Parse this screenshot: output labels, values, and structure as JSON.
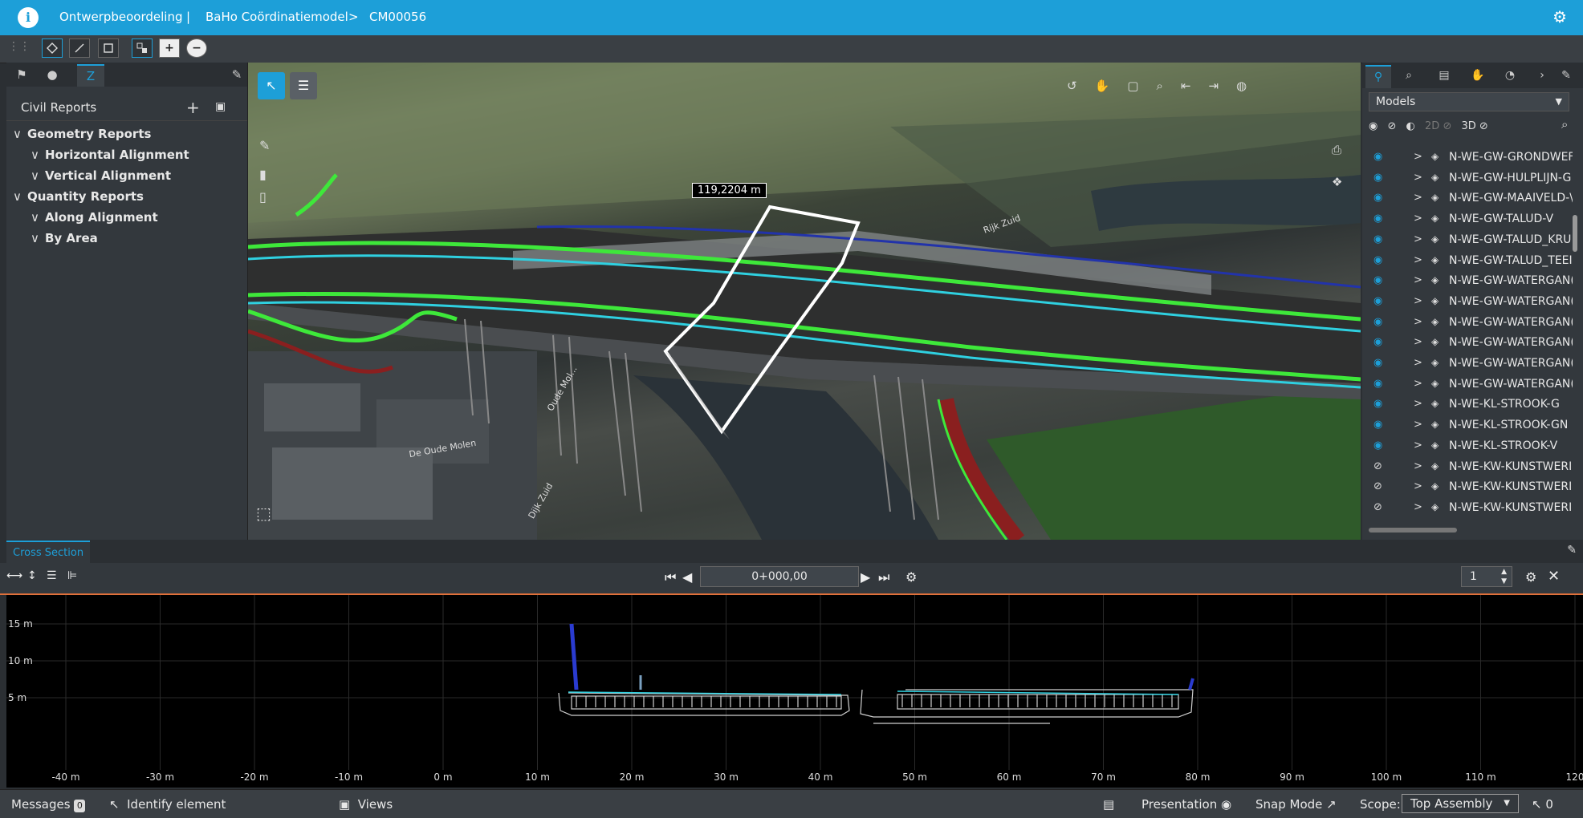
{
  "header": {
    "logo_glyph": "i",
    "project": "Ontwerpbeoordeling",
    "separator": "|",
    "model": "BaHo Coördinatiemodel",
    "arrow": ">",
    "issue": "CM00056",
    "settings_glyph": "⚙",
    "bg_color": "#1d9fd8"
  },
  "toolbar": {
    "tools": [
      "grip-icon",
      "point-tool-icon",
      "line-tool-icon",
      "rectangle-tool-icon",
      "model-tool-icon",
      "add-icon",
      "remove-icon"
    ]
  },
  "left_panel": {
    "tabs": [
      "flag-icon",
      "markup-icon",
      "civil-reports-icon"
    ],
    "title": "Civil Reports",
    "add_glyph": "+",
    "tree": [
      {
        "label": "Geometry Reports",
        "level": 0
      },
      {
        "label": "Horizontal Alignment",
        "level": 1
      },
      {
        "label": "Vertical Alignment",
        "level": 1
      },
      {
        "label": "Quantity Reports",
        "level": 0
      },
      {
        "label": "Along Alignment",
        "level": 1
      },
      {
        "label": "By Area",
        "level": 1
      }
    ]
  },
  "view3d": {
    "measurement": "119,2204 m",
    "road_labels": [
      "Rijk Zuid",
      "De Oude Molen",
      "Oude Mol...",
      "Dijk Zuid"
    ]
  },
  "right_panel": {
    "tabs": [
      "tree-icon",
      "search-icon",
      "properties-icon",
      "hand-icon",
      "object-icon",
      "more-icon",
      "pin-icon"
    ],
    "selector": "Models",
    "vis_labels": {
      "two_d": "2D",
      "three_d": "3D"
    },
    "models": [
      {
        "name": "N-WE-GW-GRONDWEF",
        "visible": true
      },
      {
        "name": "N-WE-GW-HULPLIJN-G",
        "visible": true
      },
      {
        "name": "N-WE-GW-MAAIVELD-\\",
        "visible": true
      },
      {
        "name": "N-WE-GW-TALUD-V",
        "visible": true
      },
      {
        "name": "N-WE-GW-TALUD_KRU",
        "visible": true
      },
      {
        "name": "N-WE-GW-TALUD_TEEI",
        "visible": true
      },
      {
        "name": "N-WE-GW-WATERGAN(",
        "visible": true
      },
      {
        "name": "N-WE-GW-WATERGAN(",
        "visible": true
      },
      {
        "name": "N-WE-GW-WATERGAN(",
        "visible": true
      },
      {
        "name": "N-WE-GW-WATERGAN(",
        "visible": true
      },
      {
        "name": "N-WE-GW-WATERGAN(",
        "visible": true
      },
      {
        "name": "N-WE-GW-WATERGAN(",
        "visible": true
      },
      {
        "name": "N-WE-KL-STROOK-G",
        "visible": true
      },
      {
        "name": "N-WE-KL-STROOK-GN",
        "visible": true
      },
      {
        "name": "N-WE-KL-STROOK-V",
        "visible": true
      },
      {
        "name": "N-WE-KW-KUNSTWERI",
        "visible": false
      },
      {
        "name": "N-WE-KW-KUNSTWERI",
        "visible": false
      },
      {
        "name": "N-WE-KW-KUNSTWERI",
        "visible": false
      }
    ]
  },
  "cross_section": {
    "tab": "Cross Section",
    "station": "0+000,00",
    "step": "1",
    "x_ticks": [
      "-40 m",
      "-30 m",
      "-20 m",
      "-10 m",
      "0 m",
      "10 m",
      "20 m",
      "30 m",
      "40 m",
      "50 m",
      "60 m",
      "70 m",
      "80 m",
      "90 m",
      "100 m",
      "110 m",
      "120"
    ],
    "y_ticks": [
      "15 m",
      "10 m",
      "5 m"
    ],
    "accent_color": "#e0703a"
  },
  "statusbar": {
    "messages": "Messages",
    "messages_badge": "0",
    "identify": "Identify element",
    "views": "Views",
    "presentation": "Presentation",
    "snap_mode": "Snap Mode",
    "scope_label": "Scope:",
    "scope_value": "Top Assembly",
    "selection_count": "0"
  }
}
